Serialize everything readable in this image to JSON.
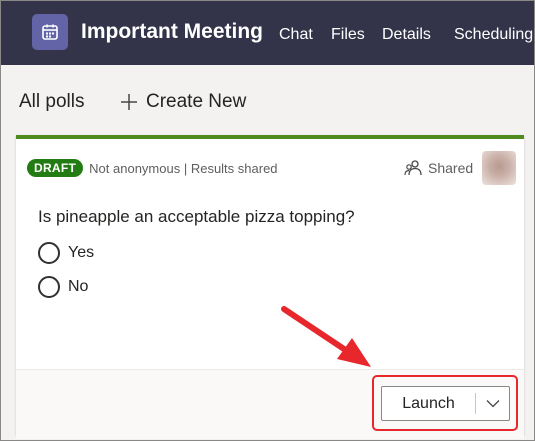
{
  "header": {
    "icon": "calendar-icon",
    "title": "Important Meeting",
    "tabs": [
      {
        "label": "Chat"
      },
      {
        "label": "Files"
      },
      {
        "label": "Details"
      },
      {
        "label": "Scheduling"
      }
    ],
    "background": "#33344a",
    "icon_color": "#6264a7"
  },
  "toolbar": {
    "title": "All polls",
    "create_icon": "plus-icon",
    "create_label": "Create New"
  },
  "poll": {
    "status": "DRAFT",
    "status_color": "#237b13",
    "accent_color": "#4e8a1e",
    "meta": "Not anonymous | Results shared",
    "shared_icon": "people-icon",
    "shared_label": "Shared",
    "question": "Is pineapple an acceptable pizza topping?",
    "options": [
      {
        "label": "Yes"
      },
      {
        "label": "No"
      }
    ],
    "launch_label": "Launch",
    "launch_dropdown_icon": "chevron-down-icon"
  },
  "annotation": {
    "arrow_color": "#e8272c",
    "highlight_color": "#e8272c"
  }
}
